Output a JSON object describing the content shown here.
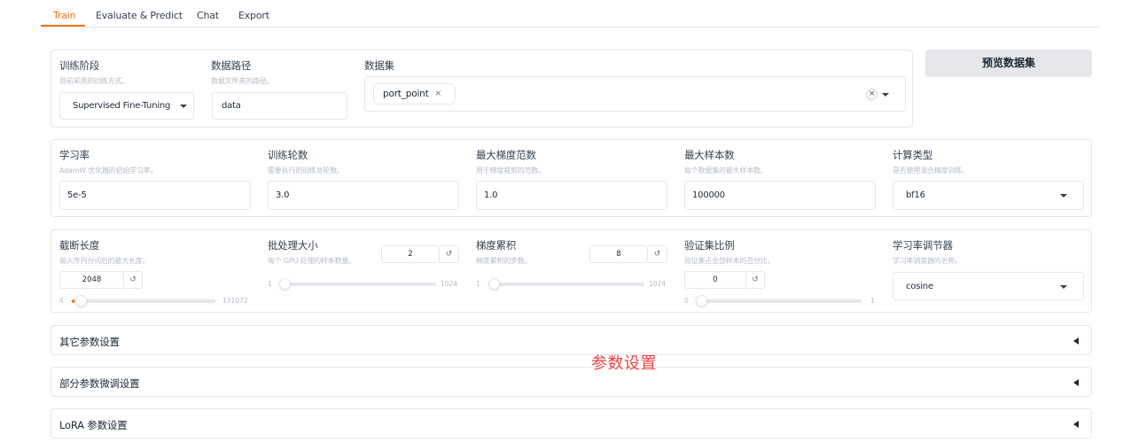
{
  "tabs": [
    {
      "label": "Train",
      "active": true
    },
    {
      "label": "Evaluate & Predict",
      "active": false
    },
    {
      "label": "Chat",
      "active": false
    },
    {
      "label": "Export",
      "active": false
    }
  ],
  "stage": {
    "label": "训练阶段",
    "info": "目前采用的训练方式。",
    "value": "Supervised Fine-Tuning"
  },
  "dataset_dir": {
    "label": "数据路径",
    "info": "数据文件夹的路径。",
    "value": "data"
  },
  "dataset": {
    "label": "数据集",
    "chips": [
      "port_point"
    ],
    "chip_remove": "×",
    "clear": "×"
  },
  "preview_button": "预览数据集",
  "learning_rate": {
    "label": "学习率",
    "info": "AdamW 优化器的初始学习率。",
    "value": "5e-5"
  },
  "num_epochs": {
    "label": "训练轮数",
    "info": "需要执行的训练总轮数。",
    "value": "3.0"
  },
  "max_grad_norm": {
    "label": "最大梯度范数",
    "info": "用于梯度裁剪的范数。",
    "value": "1.0"
  },
  "max_samples": {
    "label": "最大样本数",
    "info": "每个数据集的最大样本数。",
    "value": "100000"
  },
  "compute_type": {
    "label": "计算类型",
    "info": "是否使用混合精度训练。",
    "value": "bf16"
  },
  "cutoff_len": {
    "label": "截断长度",
    "info": "输入序列分词后的最大长度。",
    "value": "2048",
    "min": "4",
    "max": "131072",
    "fraction": 0.016
  },
  "batch_size": {
    "label": "批处理大小",
    "info": "每个 GPU 处理的样本数量。",
    "value": "2",
    "min": "1",
    "max": "1024",
    "fraction": 0.001
  },
  "grad_accum": {
    "label": "梯度累积",
    "info": "梯度累积的步数。",
    "value": "8",
    "min": "1",
    "max": "1024",
    "fraction": 0.007
  },
  "val_size": {
    "label": "验证集比例",
    "info": "验证集占全部样本的百分比。",
    "value": "0",
    "min": "0",
    "max": "1",
    "fraction": 0
  },
  "lr_scheduler": {
    "label": "学习率调节器",
    "info": "学习率调度器的名称。",
    "value": "cosine"
  },
  "reset_glyph": "↺",
  "accordions": [
    {
      "label": "其它参数设置"
    },
    {
      "label": "部分参数微调设置"
    },
    {
      "label": "LoRA 参数设置"
    }
  ],
  "annotation": "参数设置",
  "colors": {
    "accent": "#f97316",
    "annotation": "#ef4444"
  }
}
